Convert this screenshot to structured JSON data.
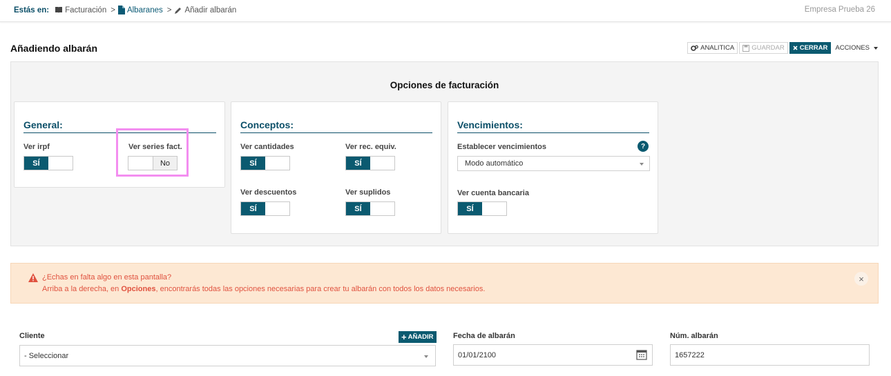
{
  "breadcrumb": {
    "label": "Estás en:",
    "items": [
      {
        "text": "Facturación",
        "sep": ">"
      },
      {
        "text": "Albaranes",
        "sep": ">"
      },
      {
        "text": "Añadir albarán",
        "sep": ""
      }
    ]
  },
  "company": "Empresa Prueba 26",
  "page_title": "Añadiendo albarán",
  "toolbar": {
    "analitica": "ANALITICA",
    "guardar": "GUARDAR",
    "cerrar": "CERRAR",
    "acciones": "ACCIONES"
  },
  "options": {
    "title": "Opciones de facturación",
    "general": {
      "heading": "General:",
      "ver_irpf": {
        "label": "Ver irpf",
        "on": "SÍ"
      },
      "ver_series": {
        "label": "Ver series fact.",
        "off": "No"
      }
    },
    "conceptos": {
      "heading": "Conceptos:",
      "ver_cantidades": {
        "label": "Ver cantidades",
        "on": "SÍ"
      },
      "ver_rec_equiv": {
        "label": "Ver rec. equiv.",
        "on": "SÍ"
      },
      "ver_descuentos": {
        "label": "Ver descuentos",
        "on": "SÍ"
      },
      "ver_suplidos": {
        "label": "Ver suplidos",
        "on": "SÍ"
      }
    },
    "vencimientos": {
      "heading": "Vencimientos:",
      "establecer": {
        "label": "Establecer vencimientos",
        "value": "Modo automático",
        "help": "?"
      },
      "cuenta": {
        "label": "Ver cuenta bancaria",
        "on": "SÍ"
      }
    }
  },
  "alert": {
    "line1": "¿Echas en falta algo en esta pantalla?",
    "line2_pre": "Arriba a la derecha, en ",
    "line2_bold": "Opciones",
    "line2_post": ", encontrarás todas las opciones necesarias para crear tu albarán con todos los datos necesarios.",
    "close": "×"
  },
  "form": {
    "cliente": {
      "label": "Cliente",
      "value": "- Seleccionar",
      "add": "AÑADIR"
    },
    "fecha": {
      "label": "Fecha de albarán",
      "value": "01/01/2100"
    },
    "numero": {
      "label": "Núm. albarán",
      "value": "1657222"
    }
  },
  "colors": {
    "brand": "#0b5a70",
    "alert_text": "#e0523f",
    "alert_bg": "#fde8d3",
    "highlight": "#f38ef0"
  }
}
